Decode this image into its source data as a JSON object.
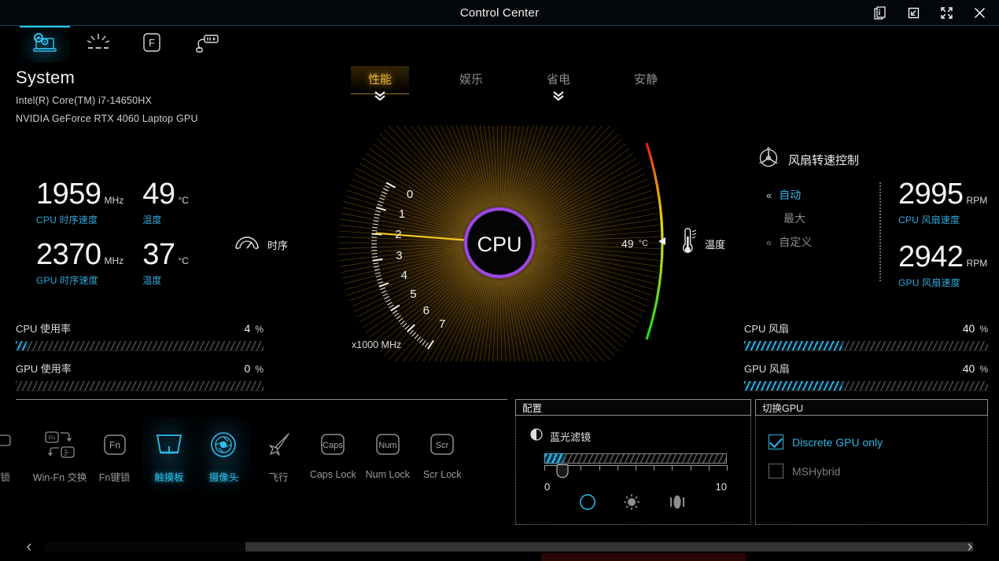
{
  "window": {
    "title": "Control Center",
    "buttons": [
      {
        "name": "info-icon",
        "label": "Info"
      },
      {
        "name": "minimize-to-tray-icon",
        "label": "Minimize"
      },
      {
        "name": "fullscreen-icon",
        "label": "Fullscreen"
      },
      {
        "name": "close-icon",
        "label": "Close"
      }
    ]
  },
  "nav": {
    "items": [
      {
        "name": "system-icon",
        "label": "System",
        "active": true
      },
      {
        "name": "keyboard-backlight-icon",
        "label": "Keyboard Light",
        "active": false
      },
      {
        "name": "fn-key-icon",
        "label": "Fn Key",
        "active": false
      },
      {
        "name": "power-charge-icon",
        "label": "Power",
        "active": false
      }
    ]
  },
  "system": {
    "title": "System",
    "cpu_model": "Intel(R) Core(TM) i7-14650HX",
    "gpu_model": "NVIDIA GeForce RTX 4060 Laptop GPU"
  },
  "modes": {
    "tabs": [
      {
        "label": "性能",
        "active": true,
        "chevron": "»"
      },
      {
        "label": "娱乐",
        "active": false,
        "chevron": ""
      },
      {
        "label": "省电",
        "active": false,
        "chevron": "»"
      },
      {
        "label": "安静",
        "active": false,
        "chevron": ""
      }
    ]
  },
  "readouts": {
    "cpu_clock": {
      "value": "1959",
      "unit": "MHz",
      "label": "CPU 时序速度"
    },
    "cpu_temp": {
      "value": "49",
      "unit": "°C",
      "label": "温度"
    },
    "gpu_clock": {
      "value": "2370",
      "unit": "MHz",
      "label": "GPU 时序速度"
    },
    "gpu_temp": {
      "value": "37",
      "unit": "°C",
      "label": "温度"
    },
    "clock_group_label": "时序",
    "clock_group_icon": "speedometer-icon"
  },
  "gauge": {
    "center_label": "CPU",
    "scale_unit": "x1000 MHz",
    "ticks": [
      "7",
      "6",
      "5",
      "4",
      "3",
      "2",
      "1",
      "0"
    ],
    "needle_value": 1.959,
    "max": 7,
    "temp_readout": "49",
    "temp_unit": "°C",
    "temp_label": "温度",
    "temp_icon": "thermometer-icon",
    "ring_color": "#8a3fd6",
    "needle_color": "#f0c020"
  },
  "fan_control": {
    "title": "风扇转速控制",
    "icon": "fan-icon",
    "modes": [
      {
        "label": "自动",
        "active": true,
        "chevron": true
      },
      {
        "label": "最大",
        "active": false,
        "chevron": false
      },
      {
        "label": "自定义",
        "active": false,
        "chevron": true
      }
    ],
    "cpu_fan": {
      "value": "2995",
      "unit": "RPM",
      "label": "CPU 风扇速度"
    },
    "gpu_fan": {
      "value": "2942",
      "unit": "RPM",
      "label": "GPU 风扇速度"
    }
  },
  "meters": {
    "left": [
      {
        "name": "CPU 使用率",
        "value": "4",
        "unit": "%",
        "percent": 4
      },
      {
        "name": "GPU 使用率",
        "value": "0",
        "unit": "%",
        "percent": 0
      }
    ],
    "right": [
      {
        "name": "CPU 风扇",
        "value": "40",
        "unit": "%",
        "percent": 40
      },
      {
        "name": "GPU 风扇",
        "value": "40",
        "unit": "%",
        "percent": 40
      }
    ]
  },
  "function_keys": [
    {
      "label": "锁",
      "icon": "lock-key-icon",
      "active": false,
      "clipped": true
    },
    {
      "label": "Win-Fn 交换",
      "icon": "win-fn-swap-icon",
      "active": false
    },
    {
      "label": "Fn键锁",
      "icon": "fn-lock-icon",
      "active": false
    },
    {
      "label": "触摸板",
      "icon": "touchpad-icon",
      "active": true
    },
    {
      "label": "摄像头",
      "icon": "camera-icon",
      "active": true
    },
    {
      "label": "飞行",
      "icon": "airplane-icon",
      "active": false
    },
    {
      "label": "Caps Lock",
      "icon": "caps-lock-icon",
      "active": false
    },
    {
      "label": "Num Lock",
      "icon": "num-lock-icon",
      "active": false
    },
    {
      "label": "Scr Lock",
      "icon": "scr-lock-icon",
      "active": false
    }
  ],
  "config_panel": {
    "title": "配置",
    "filter_label": "蓝光滤镜",
    "filter_icon": "half-moon-icon",
    "slider": {
      "value": 1,
      "min_label": "0",
      "max_label": "10",
      "min": 0,
      "max": 10
    },
    "icons": [
      {
        "name": "blue-light-icon",
        "active": true
      },
      {
        "name": "brightness-icon",
        "active": false
      },
      {
        "name": "contrast-icon",
        "active": false
      }
    ]
  },
  "gpu_panel": {
    "title": "切换GPU",
    "options": [
      {
        "label": "Discrete GPU only",
        "checked": true
      },
      {
        "label": "MSHybrid",
        "checked": false
      }
    ]
  },
  "footer": {
    "left_arrow": "‹",
    "right_arrow": "›"
  },
  "colors": {
    "accent_cyan": "#2fb4e8",
    "accent_gold": "#e8b339",
    "ring_purple": "#8a3fd6"
  }
}
